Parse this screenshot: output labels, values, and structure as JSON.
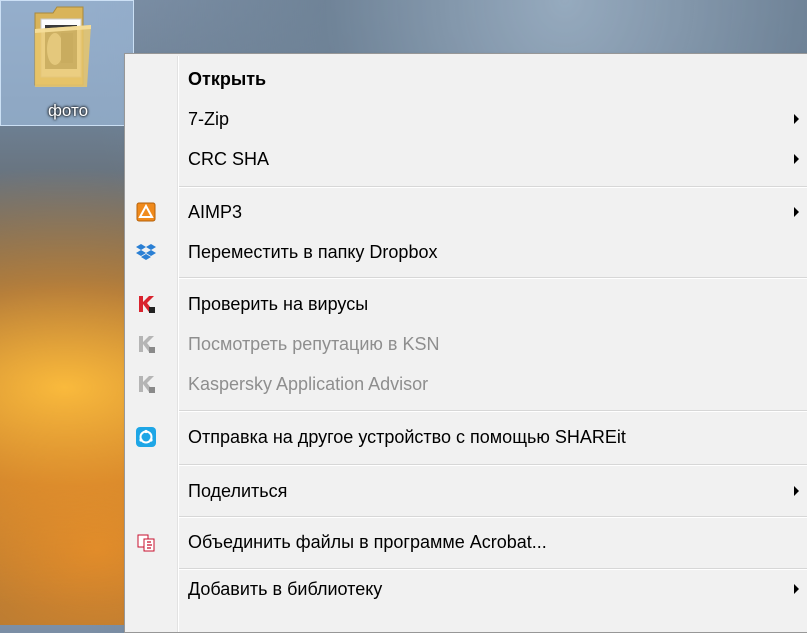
{
  "desktop": {
    "folder": {
      "label": "фото",
      "icon": "folder-icon"
    }
  },
  "context_menu": {
    "items": [
      {
        "label": "Открыть",
        "bold": true
      },
      {
        "label": "7-Zip",
        "submenu": true
      },
      {
        "label": "CRC SHA",
        "submenu": true
      },
      {
        "label": "AIMP3",
        "submenu": true,
        "icon": "aimp-icon"
      },
      {
        "label": "Переместить в папку Dropbox",
        "icon": "dropbox-icon"
      },
      {
        "label": "Проверить на вирусы",
        "icon": "kaspersky-icon"
      },
      {
        "label": "Посмотреть репутацию в KSN",
        "disabled": true,
        "icon": "kaspersky-icon"
      },
      {
        "label": "Kaspersky Application Advisor",
        "disabled": true,
        "icon": "kaspersky-icon"
      },
      {
        "label": "Отправка на другое устройство с помощью SHAREit",
        "icon": "shareit-icon"
      },
      {
        "label": "Поделиться",
        "submenu": true
      },
      {
        "label": "Объединить файлы в программе Acrobat...",
        "icon": "acrobat-icon"
      },
      {
        "label": "Добавить в библиотеку",
        "submenu": true
      }
    ]
  },
  "colors": {
    "menu_background": "#f1f1f1",
    "disabled_text": "#8e8e8e",
    "aimp_orange": "#f08a1c",
    "dropbox_blue": "#2a7fd4",
    "kaspersky_red": "#d9232e",
    "shareit_blue": "#1ea6e6",
    "acrobat_red": "#c8102e"
  }
}
